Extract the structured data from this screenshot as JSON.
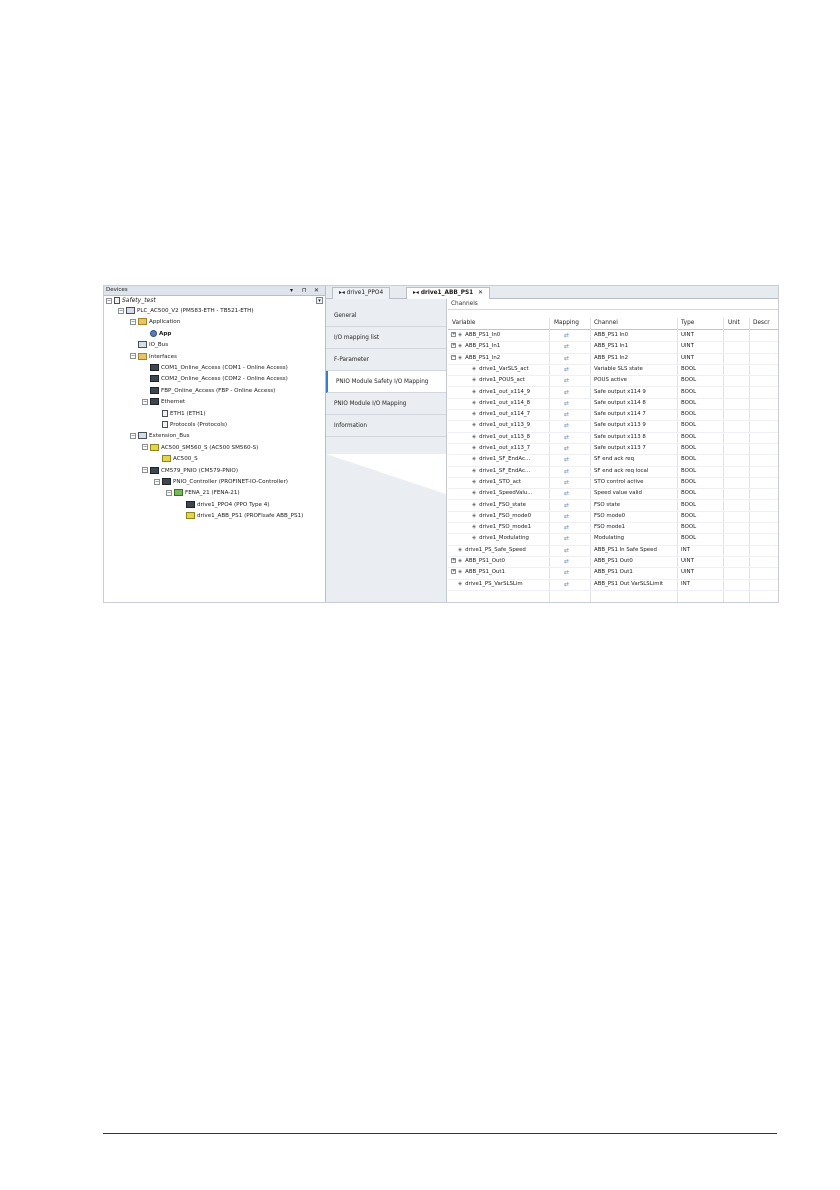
{
  "devices": {
    "title": "Devices",
    "ctrl_pin": "▾",
    "ctrl_float": "⊓",
    "ctrl_close": "✕",
    "root": "Safety_test",
    "nodes": [
      {
        "label": "PLC_AC500_V2 (PM583-ETH - TB521-ETH)",
        "icon": "plc"
      },
      {
        "label": "Application",
        "icon": "folder"
      },
      {
        "label": "App",
        "icon": "app"
      },
      {
        "label": "IO_Bus",
        "icon": "plc"
      },
      {
        "label": "Interfaces",
        "icon": "folder"
      },
      {
        "label": "COM1_Online_Access (COM1 - Online Access)",
        "icon": "dark"
      },
      {
        "label": "COM2_Online_Access (COM2 - Online Access)",
        "icon": "dark"
      },
      {
        "label": "FBP_Online_Access (FBP - Online Access)",
        "icon": "dark"
      },
      {
        "label": "Ethernet",
        "icon": "dark"
      },
      {
        "label": "ETH1 (ETH1)",
        "icon": "doc"
      },
      {
        "label": "Protocols (Protocols)",
        "icon": "doc"
      },
      {
        "label": "Extension_Bus",
        "icon": "plc"
      },
      {
        "label": "AC500_SM560_S (AC500 SM560-S)",
        "icon": "yel"
      },
      {
        "label": "AC500_S",
        "icon": "yel"
      },
      {
        "label": "CM579_PNIO (CM579-PNIO)",
        "icon": "dark"
      },
      {
        "label": "PNIO_Controller (PROFINET-IO-Controller)",
        "icon": "dark"
      },
      {
        "label": "FENA_21 (FENA-21)",
        "icon": "grn"
      },
      {
        "label": "drive1_PPO4 (PPO Type 4)",
        "icon": "dark"
      },
      {
        "label": "drive1_ABB_PS1 (PROFIsafe ABB_PS1)",
        "icon": "yel"
      }
    ]
  },
  "tabs": [
    {
      "label": "drive1_PPO4"
    },
    {
      "label": "drive1_ABB_PS1",
      "close": "✕"
    }
  ],
  "left_nav": [
    {
      "label": "General"
    },
    {
      "label": "I/O mapping list"
    },
    {
      "label": "F-Parameter"
    },
    {
      "label": "PNIO Module Safety I/O Mapping"
    },
    {
      "label": "PNIO Module I/O Mapping"
    },
    {
      "label": "Information"
    }
  ],
  "channels": {
    "title": "Channels",
    "headers": {
      "variable": "Variable",
      "mapping": "Mapping",
      "channel": "Channel",
      "type": "Type",
      "unit": "Unit",
      "desc": "Descr"
    },
    "rows": [
      {
        "variable": "ABB_PS1_In0",
        "channel": "ABB_PS1 In0",
        "type": "UINT",
        "level": 0,
        "exp": "+"
      },
      {
        "variable": "ABB_PS1_In1",
        "channel": "ABB_PS1 In1",
        "type": "UINT",
        "level": 0,
        "exp": "+"
      },
      {
        "variable": "ABB_PS1_In2",
        "channel": "ABB_PS1 In2",
        "type": "UINT",
        "level": 0,
        "exp": "−"
      },
      {
        "variable": "drive1_VarSLS_act",
        "channel": "Variable SLS state",
        "type": "BOOL",
        "level": 1
      },
      {
        "variable": "drive1_POUS_act",
        "channel": "POUS active",
        "type": "BOOL",
        "level": 1
      },
      {
        "variable": "drive1_out_x114_9",
        "channel": "Safe output x114 9",
        "type": "BOOL",
        "level": 1
      },
      {
        "variable": "drive1_out_x114_8",
        "channel": "Safe output x114 8",
        "type": "BOOL",
        "level": 1
      },
      {
        "variable": "drive1_out_x114_7",
        "channel": "Safe output x114 7",
        "type": "BOOL",
        "level": 1
      },
      {
        "variable": "drive1_out_x113_9",
        "channel": "Safe output x113 9",
        "type": "BOOL",
        "level": 1
      },
      {
        "variable": "drive1_out_x113_8",
        "channel": "Safe output x113 8",
        "type": "BOOL",
        "level": 1
      },
      {
        "variable": "drive1_out_x113_7",
        "channel": "Safe output x113 7",
        "type": "BOOL",
        "level": 1
      },
      {
        "variable": "drive1_SF_EndAc...",
        "channel": "SF end ack req",
        "type": "BOOL",
        "level": 1
      },
      {
        "variable": "drive1_SF_EndAc...",
        "channel": "SF end ack req local",
        "type": "BOOL",
        "level": 1
      },
      {
        "variable": "drive1_STO_act",
        "channel": "STO control active",
        "type": "BOOL",
        "level": 1
      },
      {
        "variable": "drive1_SpeedValu...",
        "channel": "Speed value valid",
        "type": "BOOL",
        "level": 1
      },
      {
        "variable": "drive1_FSO_state",
        "channel": "FSO state",
        "type": "BOOL",
        "level": 1
      },
      {
        "variable": "drive1_FSO_mode0",
        "channel": "FSO mode0",
        "type": "BOOL",
        "level": 1
      },
      {
        "variable": "drive1_FSO_mode1",
        "channel": "FSO mode1",
        "type": "BOOL",
        "level": 1
      },
      {
        "variable": "drive1_Modulating",
        "channel": "Modulating",
        "type": "BOOL",
        "level": 1
      },
      {
        "variable": "drive1_PS_Safe_Speed",
        "channel": "ABB_PS1 In Safe Speed",
        "type": "INT",
        "level": 0
      },
      {
        "variable": "ABB_PS1_Out0",
        "channel": "ABB_PS1 Out0",
        "type": "UINT",
        "level": 0,
        "exp": "+"
      },
      {
        "variable": "ABB_PS1_Out1",
        "channel": "ABB_PS1 Out1",
        "type": "UINT",
        "level": 0,
        "exp": "+"
      },
      {
        "variable": "drive1_PS_VarSLSLim",
        "channel": "ABB_PS1 Out VarSLSLimit",
        "type": "INT",
        "level": 0
      }
    ]
  }
}
